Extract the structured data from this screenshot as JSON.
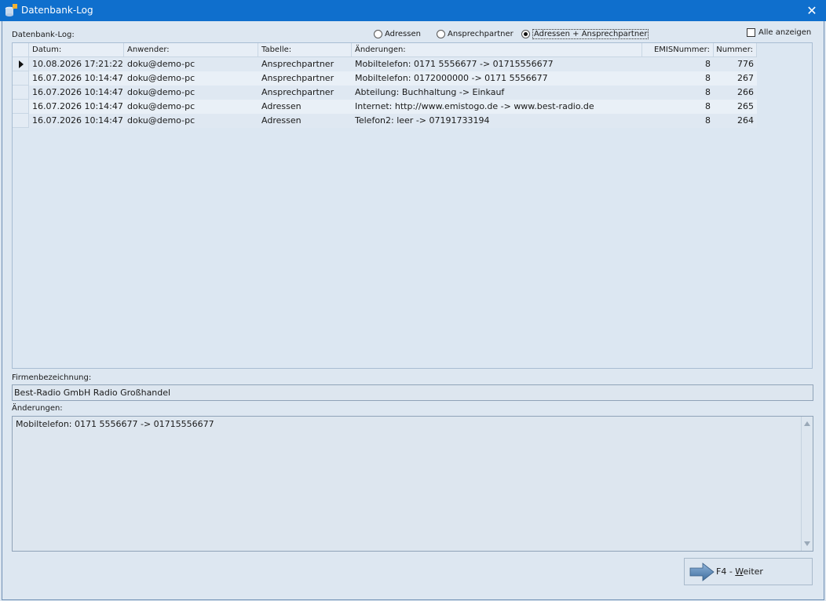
{
  "window": {
    "title": "Datenbank-Log"
  },
  "log_label": "Datenbank-Log:",
  "radios": [
    {
      "label": "Adressen",
      "checked": false
    },
    {
      "label": "Ansprechpartner",
      "checked": false
    },
    {
      "label": "Adressen + Ansprechpartner",
      "checked": true
    }
  ],
  "show_all_label": "Alle anzeigen",
  "table": {
    "columns": [
      "Datum:",
      "Anwender:",
      "Tabelle:",
      "Änderungen:",
      "EMISNummer:",
      "Nummer:"
    ],
    "rows": [
      [
        "10.08.2026 17:21:22",
        "doku@demo-pc",
        "Ansprechpartner",
        "Mobiltelefon: 0171 5556677 -> 01715556677",
        "8",
        "776"
      ],
      [
        "16.07.2026 10:14:47",
        "doku@demo-pc",
        "Ansprechpartner",
        "Mobiltelefon: 0172000000 -> 0171 5556677",
        "8",
        "267"
      ],
      [
        "16.07.2026 10:14:47",
        "doku@demo-pc",
        "Ansprechpartner",
        "Abteilung: Buchhaltung -> Einkauf",
        "8",
        "266"
      ],
      [
        "16.07.2026 10:14:47",
        "doku@demo-pc",
        "Adressen",
        "Internet: http://www.emistogo.de -> www.best-radio.de",
        "8",
        "265"
      ],
      [
        "16.07.2026 10:14:47",
        "doku@demo-pc",
        "Adressen",
        "Telefon2: leer -> 07191733194",
        "8",
        "264"
      ]
    ]
  },
  "firm_label": "Firmenbezeichnung:",
  "firm_value": "Best-Radio GmbH Radio Großhandel",
  "changes_label": "Änderungen:",
  "changes_value": "Mobiltelefon: 0171 5556677 -> 01715556677",
  "button": {
    "prefix": "F4 - ",
    "accel": "W",
    "rest": "eiter"
  },
  "colors": {
    "titlebar": "#0f6fcd",
    "background": "#dde7f1"
  }
}
